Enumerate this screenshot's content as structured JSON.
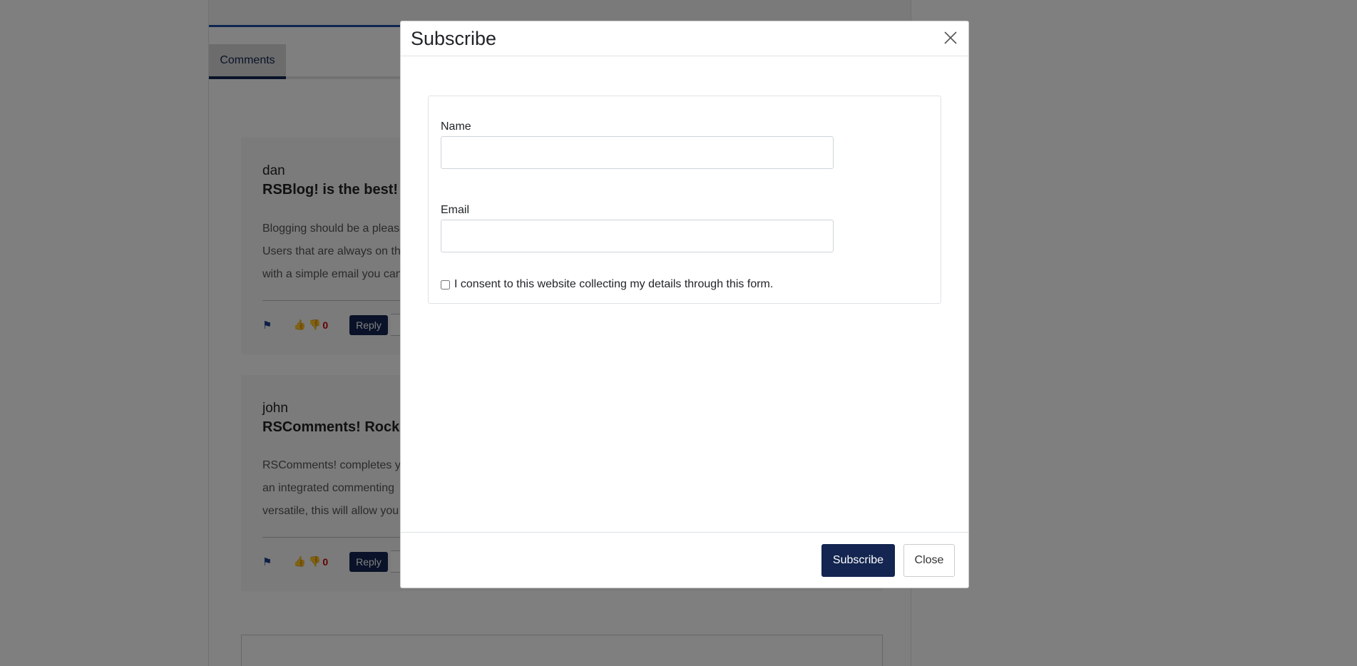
{
  "background": {
    "tab_label": "Comments",
    "comments": [
      {
        "author": "dan",
        "title": "RSBlog! is the best!",
        "lines": [
          "Blogging should be a please",
          "Users that are always on the",
          "with a simple email you can"
        ],
        "vote_count": "0",
        "reply_label": "Reply"
      },
      {
        "author": "john",
        "title": "RSComments! Rocks",
        "lines": [
          "RSComments! completes yo",
          "an integrated commenting",
          "versatile, this will allow you"
        ],
        "vote_count": "0",
        "reply_label": "Reply"
      }
    ]
  },
  "modal": {
    "title": "Subscribe",
    "close_icon": "close-icon",
    "name_label": "Name",
    "name_value": "",
    "email_label": "Email",
    "email_value": "",
    "consent_label": "I consent to this website collecting my details through this form.",
    "subscribe_label": "Subscribe",
    "close_label": "Close"
  },
  "colors": {
    "primary": "#132550",
    "accent_blue": "#1c3f8f",
    "vote_red": "#cc0000"
  }
}
